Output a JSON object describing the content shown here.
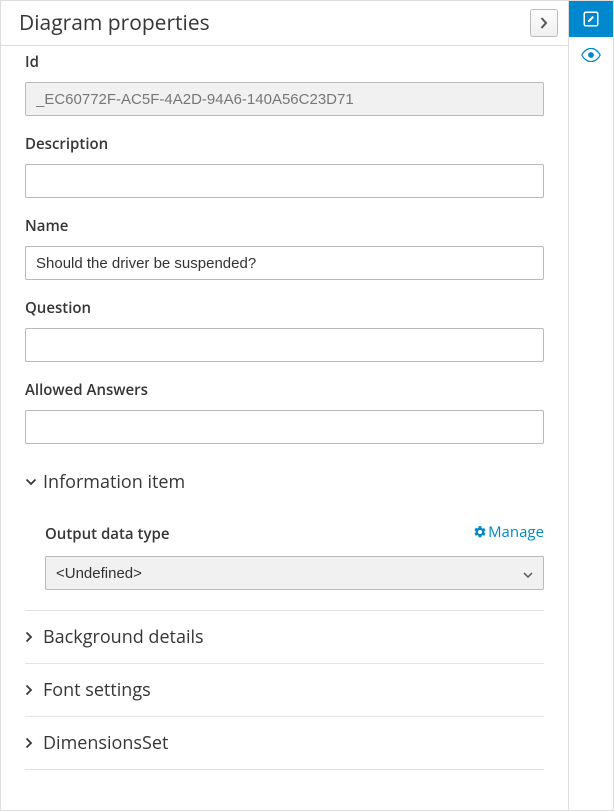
{
  "header": {
    "title": "Diagram properties"
  },
  "fields": {
    "id": {
      "label": "Id",
      "value": "_EC60772F-AC5F-4A2D-94A6-140A56C23D71"
    },
    "description": {
      "label": "Description",
      "value": ""
    },
    "name": {
      "label": "Name",
      "value": "Should the driver be suspended?"
    },
    "question": {
      "label": "Question",
      "value": ""
    },
    "allowed_answers": {
      "label": "Allowed Answers",
      "value": ""
    }
  },
  "sections": {
    "info_item": {
      "title": "Information item"
    },
    "output_type": {
      "label": "Output data type",
      "manage": "Manage",
      "value": "<Undefined>"
    },
    "background": {
      "title": "Background details"
    },
    "font": {
      "title": "Font settings"
    },
    "dimensions": {
      "title": "DimensionsSet"
    }
  },
  "icons": {
    "chevron_right": "chevron-right",
    "chevron_down": "chevron-down",
    "edit": "edit",
    "eye": "eye",
    "gear": "gear"
  }
}
